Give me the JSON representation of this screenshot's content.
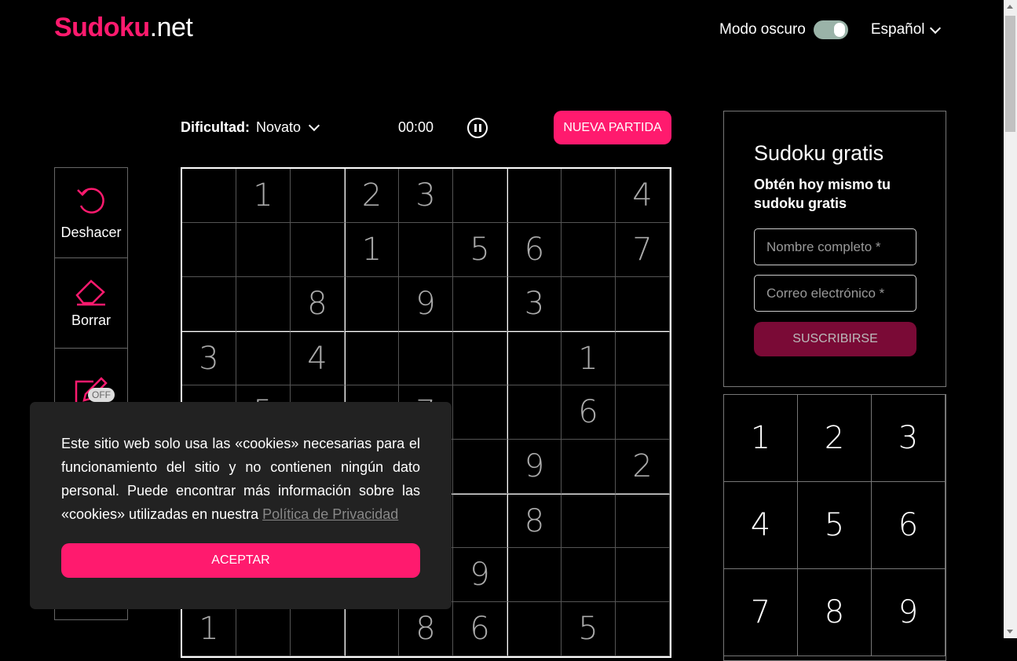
{
  "header": {
    "logo_bold": "Sudoku",
    "logo_rest": ".net",
    "dark_mode_label": "Modo oscuro",
    "dark_mode_on": true,
    "language": "Español"
  },
  "game": {
    "difficulty_label": "Dificultad:",
    "difficulty_value": "Novato",
    "timer": "00:00",
    "new_game": "NUEVA PARTIDA"
  },
  "tools": {
    "undo": "Deshacer",
    "erase": "Borrar",
    "notes_state": "OFF"
  },
  "grid": [
    [
      "",
      "1",
      "",
      "2",
      "3",
      "",
      "",
      "",
      "4"
    ],
    [
      "",
      "",
      "",
      "1",
      "",
      "5",
      "6",
      "",
      "7"
    ],
    [
      "",
      "",
      "8",
      "",
      "9",
      "",
      "3",
      "",
      ""
    ],
    [
      "3",
      "",
      "4",
      "",
      "",
      "",
      "",
      "1",
      ""
    ],
    [
      "",
      "5",
      "",
      "",
      "7",
      "",
      "",
      "6",
      ""
    ],
    [
      "",
      "",
      "",
      "",
      "",
      "",
      "9",
      "",
      "2"
    ],
    [
      "",
      "",
      "",
      "",
      "",
      "",
      "8",
      "",
      ""
    ],
    [
      "",
      "",
      "",
      "",
      "",
      "9",
      "",
      "",
      ""
    ],
    [
      "1",
      "",
      "",
      "",
      "8",
      "6",
      "",
      "5",
      ""
    ]
  ],
  "subscribe": {
    "title": "Sudoku gratis",
    "subtitle": "Obtén hoy mismo tu sudoku gratis",
    "name_placeholder": "Nombre completo *",
    "email_placeholder": "Correo electrónico *",
    "button": "SUSCRIBIRSE"
  },
  "numpad": [
    "1",
    "2",
    "3",
    "4",
    "5",
    "6",
    "7",
    "8",
    "9"
  ],
  "cookie": {
    "text": "Este sitio web solo usa las «cookies» necesarias para el funcionamiento del sitio y no contienen ningún dato personal. Puede encontrar más información sobre las «cookies» utilizadas en nuestra",
    "link": "Política de Privacidad",
    "accept": "ACEPTAR"
  },
  "colors": {
    "accent": "#ff1a6e",
    "background": "#000000"
  }
}
